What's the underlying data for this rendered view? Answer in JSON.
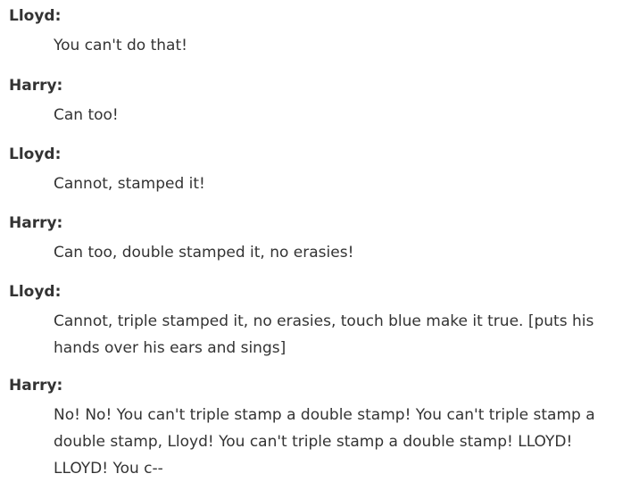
{
  "dialogue": [
    {
      "speaker": "Lloyd:",
      "line": "You can't do that!"
    },
    {
      "speaker": "Harry:",
      "line": "Can too!"
    },
    {
      "speaker": "Lloyd:",
      "line": "Cannot, stamped it!"
    },
    {
      "speaker": "Harry:",
      "line": "Can too, double stamped it, no erasies!"
    },
    {
      "speaker": "Lloyd:",
      "line": "Cannot, triple stamped it, no erasies, touch blue make it true. [puts his hands over his ears and sings]"
    },
    {
      "speaker": "Harry:",
      "line": "No! No! You can't triple stamp a double stamp! You can't triple stamp a double stamp, Lloyd! You can't triple stamp a double stamp! LLOYD! LLOYD! You c--"
    }
  ]
}
